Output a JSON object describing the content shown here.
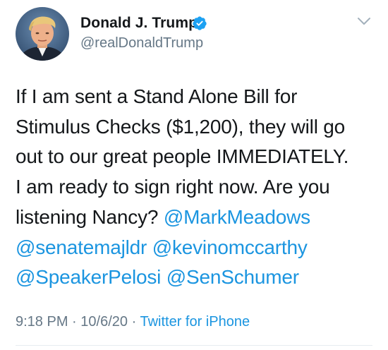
{
  "author": {
    "display_name": "Donald J. Trump",
    "handle": "@realDonaldTrump",
    "verified": true,
    "avatar": "profile-photo"
  },
  "tweet": {
    "lines": [
      "If I am sent a Stand Alone Bill for",
      "Stimulus Checks ($1,200), they will go",
      "out to our great people IMMEDIATELY.",
      "I am ready to sign right now. Are you"
    ],
    "line5_text": "listening Nancy?",
    "mentions": [
      "@MarkMeadows",
      "@senatemajldr",
      "@kevinomccarthy",
      "@SpeakerPelosi",
      "@SenSchumer"
    ]
  },
  "meta": {
    "time": "9:18 PM",
    "separator": "·",
    "date": "10/6/20",
    "source": "Twitter for iPhone"
  },
  "colors": {
    "link": "#1b95e0",
    "secondary_text": "#657786",
    "verified_badge": "#1da1f2",
    "divider": "#e6ecf0"
  },
  "icons": {
    "verified": "verified-badge-icon",
    "menu": "chevron-down-icon"
  }
}
